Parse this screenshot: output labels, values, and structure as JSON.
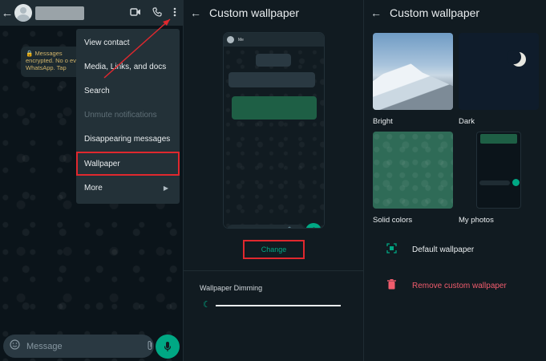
{
  "chat": {
    "menu_items": [
      {
        "label": "View contact",
        "disabled": false
      },
      {
        "label": "Media, Links, and docs",
        "disabled": false
      },
      {
        "label": "Search",
        "disabled": false
      },
      {
        "label": "Unmute notifications",
        "disabled": true
      },
      {
        "label": "Disappearing messages",
        "disabled": false
      },
      {
        "label": "Wallpaper",
        "disabled": false,
        "highlighted": true
      },
      {
        "label": "More",
        "disabled": false,
        "has_submenu": true
      }
    ],
    "encryption_notice": "Messages encrypted. No o even WhatsApp. Tap",
    "input_placeholder": "Message",
    "accent_color": "#00a884"
  },
  "wallpaper_preview": {
    "title": "Custom wallpaper",
    "preview_contact_name": "Me",
    "change_label": "Change",
    "dimming_label": "Wallpaper Dimming",
    "dimming_level": 0
  },
  "wallpaper_picker": {
    "title": "Custom wallpaper",
    "tiles": [
      {
        "label": "Bright"
      },
      {
        "label": "Dark"
      },
      {
        "label": "Solid colors"
      },
      {
        "label": "My photos"
      }
    ],
    "default_label": "Default wallpaper",
    "remove_label": "Remove custom wallpaper",
    "remove_color": "#f15c6d"
  }
}
